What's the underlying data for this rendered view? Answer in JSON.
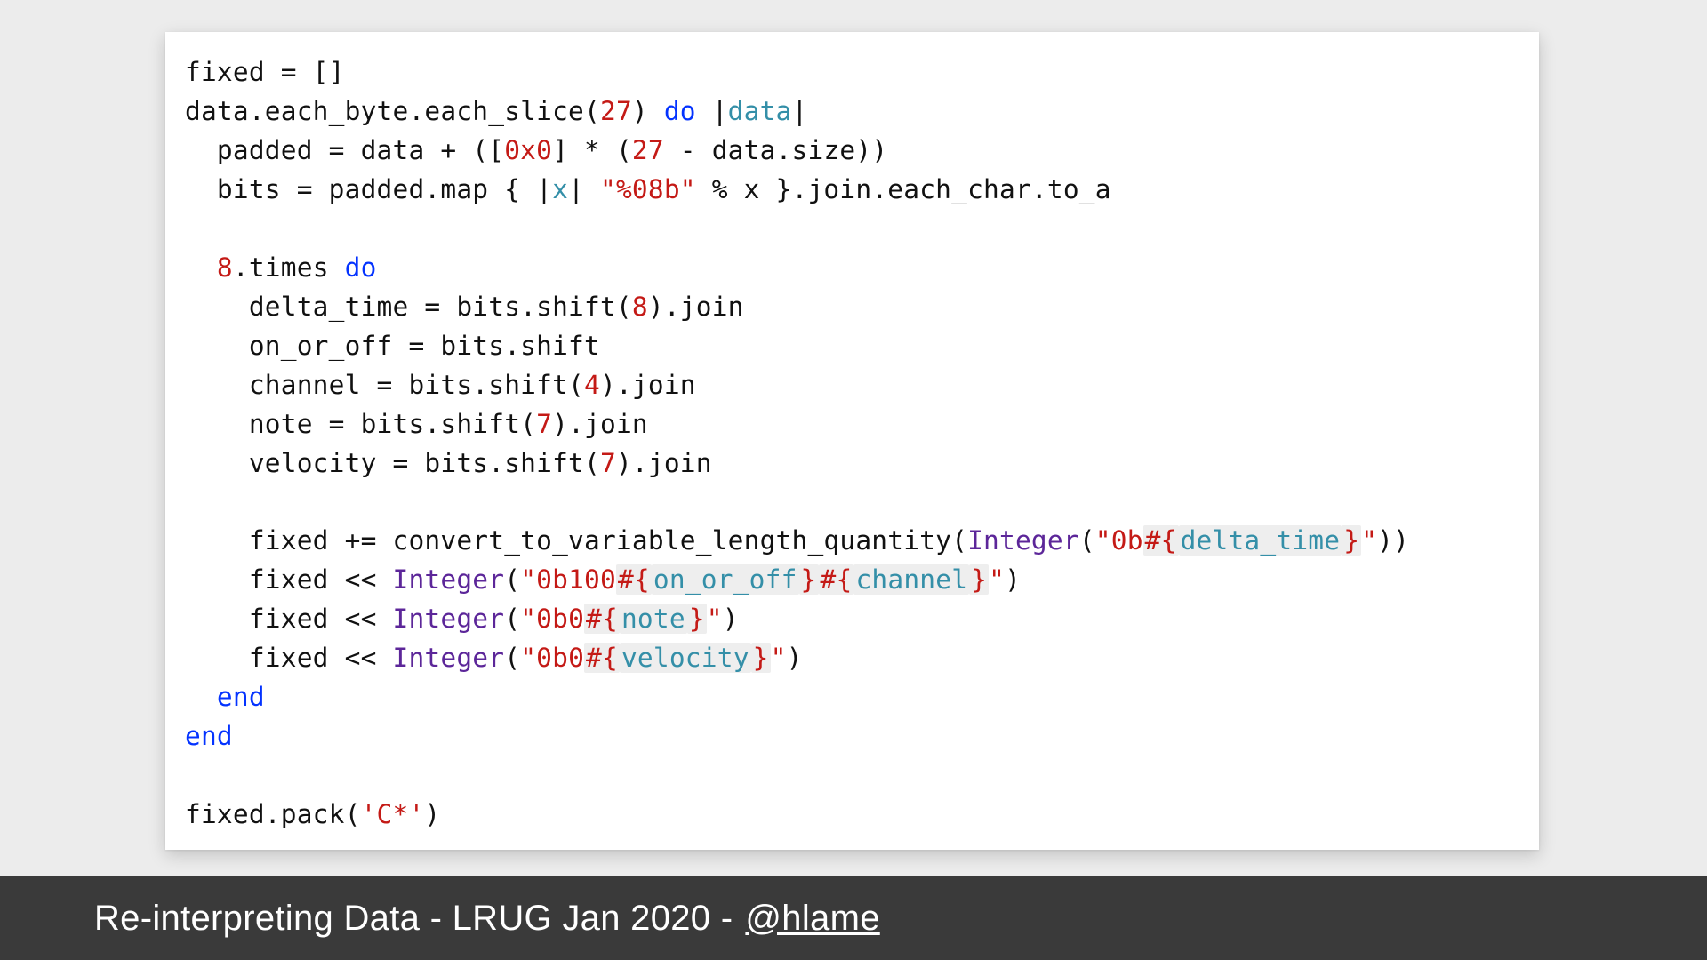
{
  "footer": {
    "text_prefix": "Re-interpreting Data - LRUG Jan 2020 - ",
    "handle": "@hlame"
  },
  "code": {
    "lines": [
      [
        {
          "t": "fixed = []"
        }
      ],
      [
        {
          "t": "data.each_byte.each_slice("
        },
        {
          "t": "27",
          "c": "tok-num"
        },
        {
          "t": ") "
        },
        {
          "t": "do",
          "c": "tok-kw"
        },
        {
          "t": " |"
        },
        {
          "t": "data",
          "c": "tok-id"
        },
        {
          "t": "|"
        }
      ],
      [
        {
          "t": "  padded = data + (["
        },
        {
          "t": "0x0",
          "c": "tok-num"
        },
        {
          "t": "] * ("
        },
        {
          "t": "27",
          "c": "tok-num"
        },
        {
          "t": " - data.size))"
        }
      ],
      [
        {
          "t": "  bits = padded.map { |"
        },
        {
          "t": "x",
          "c": "tok-id"
        },
        {
          "t": "| "
        },
        {
          "t": "\"%08b\"",
          "c": "tok-str"
        },
        {
          "t": " % x }.join.each_char.to_a"
        }
      ],
      [
        {
          "t": ""
        }
      ],
      [
        {
          "t": "  "
        },
        {
          "t": "8",
          "c": "tok-num"
        },
        {
          "t": ".times "
        },
        {
          "t": "do",
          "c": "tok-kw"
        }
      ],
      [
        {
          "t": "    delta_time = bits.shift("
        },
        {
          "t": "8",
          "c": "tok-num"
        },
        {
          "t": ").join"
        }
      ],
      [
        {
          "t": "    on_or_off = bits.shift"
        }
      ],
      [
        {
          "t": "    channel = bits.shift("
        },
        {
          "t": "4",
          "c": "tok-num"
        },
        {
          "t": ").join"
        }
      ],
      [
        {
          "t": "    note = bits.shift("
        },
        {
          "t": "7",
          "c": "tok-num"
        },
        {
          "t": ").join"
        }
      ],
      [
        {
          "t": "    velocity = bits.shift("
        },
        {
          "t": "7",
          "c": "tok-num"
        },
        {
          "t": ").join"
        }
      ],
      [
        {
          "t": ""
        }
      ],
      [
        {
          "t": "    fixed += convert_to_variable_length_quantity("
        },
        {
          "t": "Integer",
          "c": "tok-const"
        },
        {
          "t": "("
        },
        {
          "t": "\"0b",
          "c": "tok-str"
        },
        {
          "t": "#{",
          "c": "tok-str tok-interp"
        },
        {
          "t": "delta_time",
          "c": "tok-id tok-interp"
        },
        {
          "t": "}",
          "c": "tok-str tok-interp"
        },
        {
          "t": "\"",
          "c": "tok-str"
        },
        {
          "t": "))"
        }
      ],
      [
        {
          "t": "    fixed << "
        },
        {
          "t": "Integer",
          "c": "tok-const"
        },
        {
          "t": "("
        },
        {
          "t": "\"0b100",
          "c": "tok-str"
        },
        {
          "t": "#{",
          "c": "tok-str tok-interp"
        },
        {
          "t": "on_or_off",
          "c": "tok-id tok-interp"
        },
        {
          "t": "}",
          "c": "tok-str tok-interp"
        },
        {
          "t": "#{",
          "c": "tok-str tok-interp"
        },
        {
          "t": "channel",
          "c": "tok-id tok-interp"
        },
        {
          "t": "}",
          "c": "tok-str tok-interp"
        },
        {
          "t": "\"",
          "c": "tok-str"
        },
        {
          "t": ")"
        }
      ],
      [
        {
          "t": "    fixed << "
        },
        {
          "t": "Integer",
          "c": "tok-const"
        },
        {
          "t": "("
        },
        {
          "t": "\"0b0",
          "c": "tok-str"
        },
        {
          "t": "#{",
          "c": "tok-str tok-interp"
        },
        {
          "t": "note",
          "c": "tok-id tok-interp"
        },
        {
          "t": "}",
          "c": "tok-str tok-interp"
        },
        {
          "t": "\"",
          "c": "tok-str"
        },
        {
          "t": ")"
        }
      ],
      [
        {
          "t": "    fixed << "
        },
        {
          "t": "Integer",
          "c": "tok-const"
        },
        {
          "t": "("
        },
        {
          "t": "\"0b0",
          "c": "tok-str"
        },
        {
          "t": "#{",
          "c": "tok-str tok-interp"
        },
        {
          "t": "velocity",
          "c": "tok-id tok-interp"
        },
        {
          "t": "}",
          "c": "tok-str tok-interp"
        },
        {
          "t": "\"",
          "c": "tok-str"
        },
        {
          "t": ")"
        }
      ],
      [
        {
          "t": "  "
        },
        {
          "t": "end",
          "c": "tok-kw"
        }
      ],
      [
        {
          "t": "end",
          "c": "tok-kw"
        }
      ],
      [
        {
          "t": ""
        }
      ],
      [
        {
          "t": "fixed.pack("
        },
        {
          "t": "'C*'",
          "c": "tok-str"
        },
        {
          "t": ")"
        }
      ]
    ]
  }
}
